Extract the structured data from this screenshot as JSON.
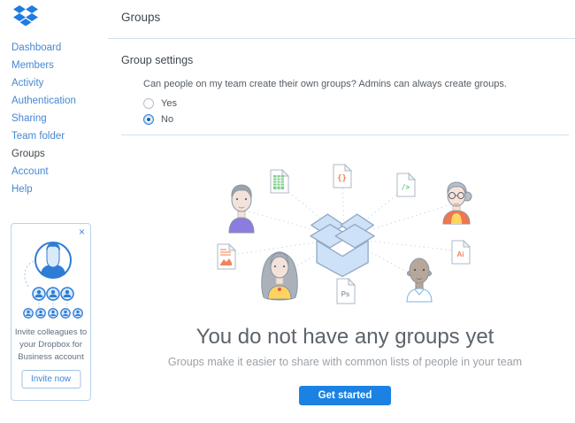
{
  "header": {
    "title": "Groups"
  },
  "sidebar": {
    "items": [
      {
        "label": "Dashboard"
      },
      {
        "label": "Members"
      },
      {
        "label": "Activity"
      },
      {
        "label": "Authentication"
      },
      {
        "label": "Sharing"
      },
      {
        "label": "Team folder"
      },
      {
        "label": "Groups",
        "active": true
      },
      {
        "label": "Account"
      },
      {
        "label": "Help"
      }
    ]
  },
  "invite_card": {
    "close_label": "×",
    "line1": "Invite colleagues to",
    "line2": "your Dropbox for",
    "line3": "Business account",
    "button_label": "Invite now"
  },
  "group_settings": {
    "title": "Group settings",
    "question": "Can people on my team create their own groups? Admins can always create groups.",
    "option_yes": "Yes",
    "option_no": "No",
    "selected_option": "No"
  },
  "empty_state": {
    "title": "You do not have any groups yet",
    "subtitle": "Groups make it easier to share with common lists of people in your team",
    "cta_label": "Get started"
  },
  "illustration": {
    "doc_braces": "{}",
    "doc_tag": "/>",
    "doc_ps": "Ps",
    "doc_ai": "Ai"
  },
  "colors": {
    "brand_blue": "#007ee5",
    "link_blue": "#4787d2",
    "cta_blue": "#1b82e3",
    "divider_blue": "#cfe3f2",
    "box_fill": "#cde2f7",
    "box_stroke": "#92a9c6"
  }
}
